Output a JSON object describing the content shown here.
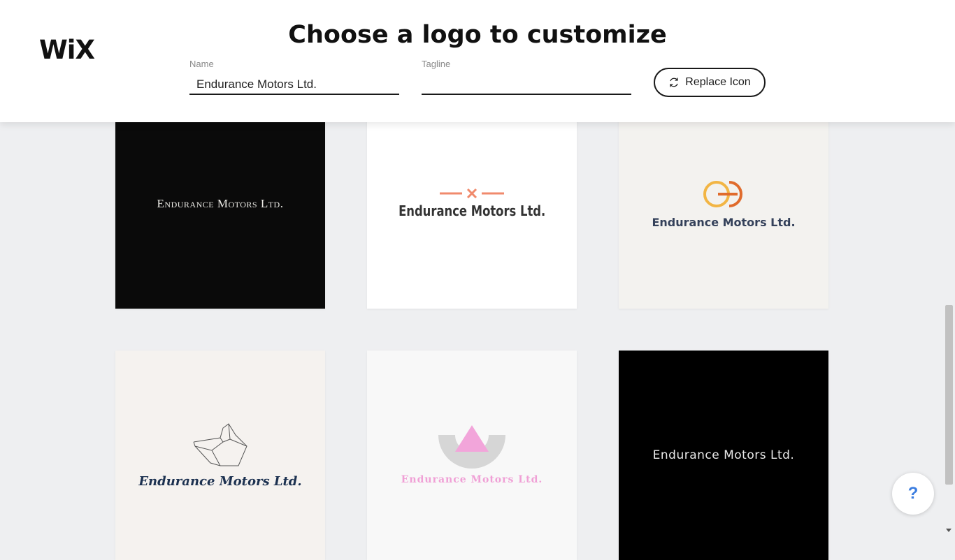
{
  "header": {
    "brand": "WiX",
    "title": "Choose a logo to customize",
    "name_label": "Name",
    "name_value": "Endurance Motors Ltd.",
    "tagline_label": "Tagline",
    "tagline_value": "",
    "replace_icon_label": "Replace Icon"
  },
  "logos": [
    {
      "text": "Endurance Motors Ltd.",
      "background": "#0a0a0a",
      "text_color": "#ecebe6"
    },
    {
      "text": "Endurance Motors Ltd.",
      "background": "#ffffff",
      "text_color": "#333333",
      "accent": "#f08a6c"
    },
    {
      "text": "Endurance Motors Ltd.",
      "background": "#f3f2ef",
      "text_color": "#34415a",
      "accent": "#f0b040"
    },
    {
      "text": "Endurance Motors Ltd.",
      "background": "#f5f2ef",
      "text_color": "#1c3150"
    },
    {
      "text": "Endurance Motors Ltd.",
      "background": "#f8f8f8",
      "text_color": "#f0a0d6"
    },
    {
      "text": "Endurance Motors Ltd.",
      "background": "#000000",
      "text_color": "#e8e8e8"
    }
  ],
  "help": {
    "label": "?"
  }
}
